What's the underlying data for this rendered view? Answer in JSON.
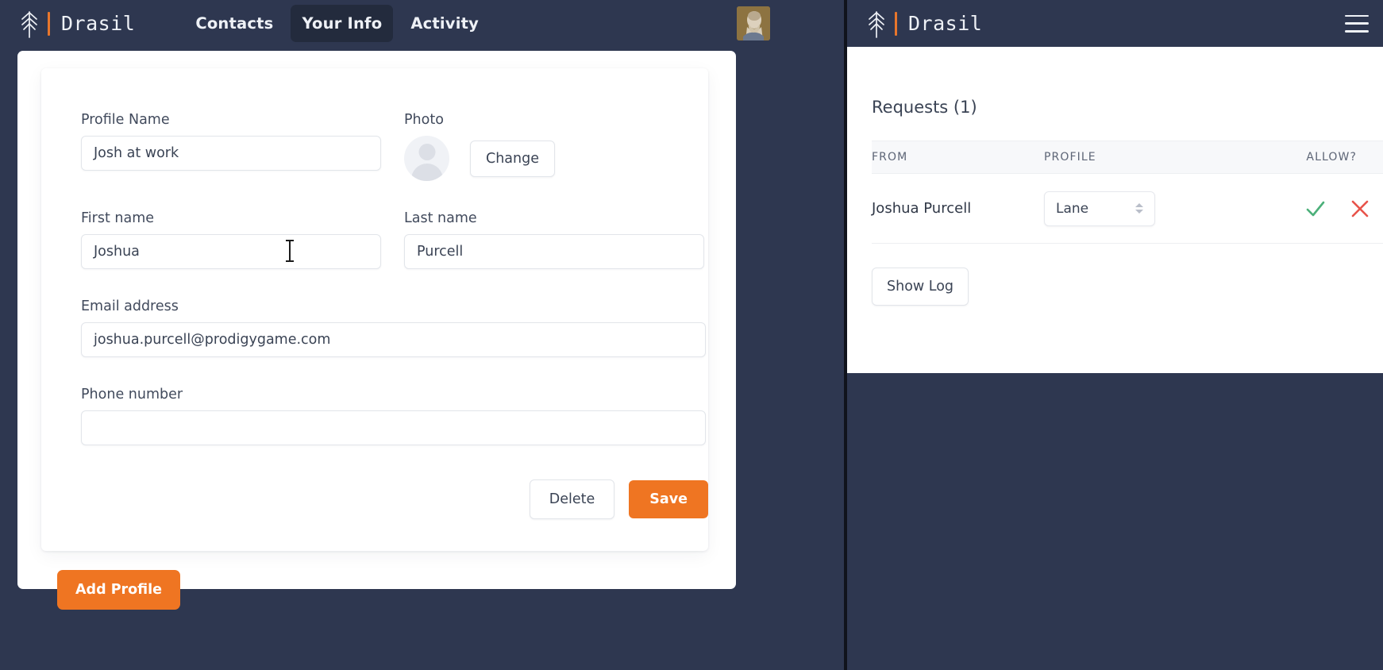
{
  "left_window": {
    "navbar": {
      "brand_name": "Drasil",
      "logo_icon": "tree-icon",
      "accent_color": "#e8762c",
      "links": [
        {
          "label": "Contacts",
          "active": false
        },
        {
          "label": "Your Info",
          "active": true
        },
        {
          "label": "Activity",
          "active": false
        }
      ],
      "avatar_icon": "user-avatar-photo"
    },
    "profile_form": {
      "fields": {
        "profile_name": {
          "label": "Profile Name",
          "value": "Josh at work",
          "placeholder": ""
        },
        "photo": {
          "label": "Photo",
          "change_button": "Change",
          "avatar_icon": "person-placeholder-icon"
        },
        "first_name": {
          "label": "First name",
          "value": "Joshua",
          "placeholder": ""
        },
        "last_name": {
          "label": "Last name",
          "value": "Purcell",
          "placeholder": ""
        },
        "email": {
          "label": "Email address",
          "value": "joshua.purcell@prodigygame.com",
          "placeholder": ""
        },
        "phone": {
          "label": "Phone number",
          "value": "",
          "placeholder": ""
        }
      },
      "delete_button": "Delete",
      "save_button": "Save",
      "add_profile_button": "Add Profile",
      "primary_color": "#ef7522"
    },
    "cursor_icon": "text-ibeam-cursor"
  },
  "right_window": {
    "navbar": {
      "brand_name": "Drasil",
      "logo_icon": "tree-icon",
      "menu_icon": "hamburger-menu-icon"
    },
    "requests": {
      "title": "Requests (1)",
      "columns": [
        "FROM",
        "PROFILE",
        "ALLOW?"
      ],
      "rows": [
        {
          "from": "Joshua Purcell",
          "profile": "Lane",
          "allow_icon": "check-icon",
          "deny_icon": "x-icon"
        }
      ],
      "allow_color": "#4cb07a",
      "deny_color": "#e8534a",
      "show_log_button": "Show Log"
    }
  }
}
